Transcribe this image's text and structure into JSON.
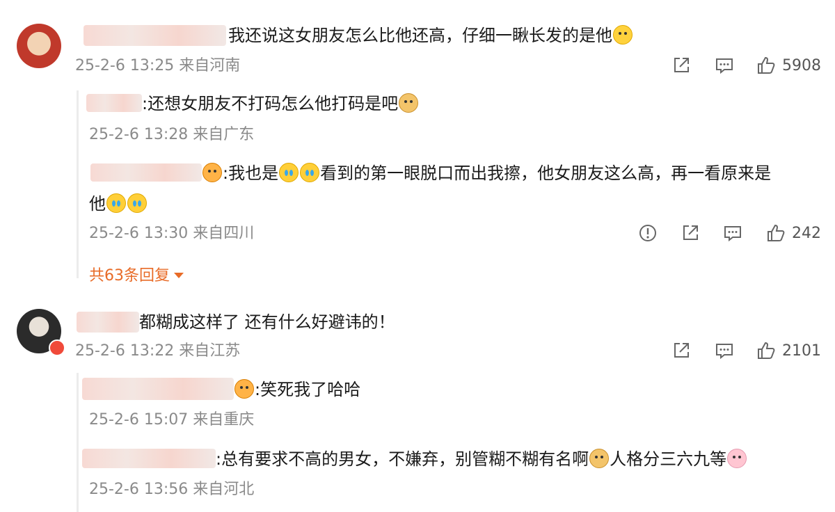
{
  "comments": [
    {
      "text": "我还说这女朋友怎么比他还高，仔细一瞅长发的是他",
      "time": "25-2-6 13:25",
      "location": "来自河南",
      "likes": "5908",
      "replies": [
        {
          "text": ":还想女朋友不打码怎么他打码是吧",
          "time": "25-2-6 13:28",
          "location": "来自广东"
        },
        {
          "text_a": ":我也是",
          "text_b": "看到的第一眼脱口而出我擦，他女朋友这么高，再一看原来是",
          "text_c": "他",
          "time": "25-2-6 13:30",
          "location": "来自四川",
          "likes": "242"
        }
      ],
      "more_replies": "共63条回复"
    },
    {
      "text": "都糊成这样了 还有什么好避讳的！",
      "time": "25-2-6 13:22",
      "location": "来自江苏",
      "likes": "2101",
      "replies": [
        {
          "text": ":笑死我了哈哈",
          "time": "25-2-6 15:07",
          "location": "来自重庆"
        },
        {
          "text_a": ":总有要求不高的男女，不嫌弃，别管糊不糊有名啊",
          "text_b": "人格分三六九等",
          "time": "25-2-6 13:56",
          "location": "来自河北"
        }
      ]
    }
  ],
  "icons": [
    "share-icon",
    "comment-icon",
    "like-icon",
    "report-icon",
    "emoji-icon",
    "avatar"
  ],
  "colors": {
    "accent": "#e86b27",
    "meta": "#8a8a8a",
    "text": "#1a1a1a"
  }
}
